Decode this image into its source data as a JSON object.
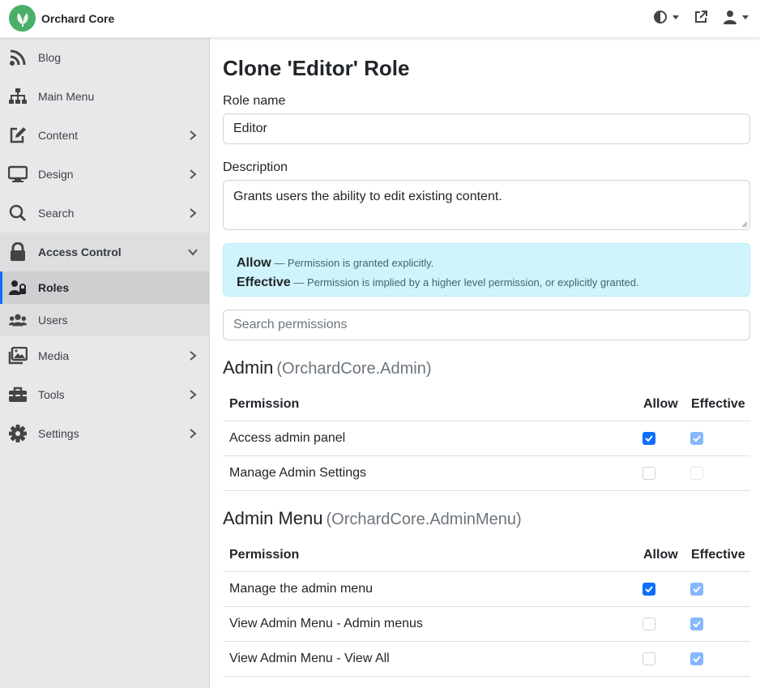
{
  "app": {
    "brand": "Orchard Core"
  },
  "sidebar": {
    "items": [
      {
        "label": "Blog",
        "icon": "rss-icon"
      },
      {
        "label": "Main Menu",
        "icon": "sitemap-icon"
      },
      {
        "label": "Content",
        "icon": "edit-icon"
      },
      {
        "label": "Design",
        "icon": "desktop-icon"
      },
      {
        "label": "Search",
        "icon": "search-icon"
      },
      {
        "label": "Access Control",
        "icon": "lock-icon"
      },
      {
        "label": "Media",
        "icon": "images-icon"
      },
      {
        "label": "Tools",
        "icon": "toolbox-icon"
      },
      {
        "label": "Settings",
        "icon": "gear-icon"
      }
    ],
    "access_children": [
      {
        "label": "Roles",
        "icon": "user-lock-icon",
        "selected": true
      },
      {
        "label": "Users",
        "icon": "users-icon",
        "selected": false
      }
    ]
  },
  "page": {
    "title": "Clone 'Editor' Role",
    "role_name_label": "Role name",
    "role_name_value": "Editor",
    "description_label": "Description",
    "description_value": "Grants users the ability to edit existing content.",
    "legend": {
      "allow_term": "Allow",
      "allow_desc": "— Permission is granted explicitly.",
      "effective_term": "Effective",
      "effective_desc": "— Permission is implied by a higher level permission, or explicitly granted."
    },
    "search_placeholder": "Search permissions"
  },
  "sections": [
    {
      "title": "Admin",
      "namespace": "(OrchardCore.Admin)",
      "headers": {
        "permission": "Permission",
        "allow": "Allow",
        "effective": "Effective"
      },
      "rows": [
        {
          "name": "Access admin panel",
          "allow": true,
          "effective": true
        },
        {
          "name": "Manage Admin Settings",
          "allow": false,
          "effective": false
        }
      ]
    },
    {
      "title": "Admin Menu",
      "namespace": "(OrchardCore.AdminMenu)",
      "headers": {
        "permission": "Permission",
        "allow": "Allow",
        "effective": "Effective"
      },
      "rows": [
        {
          "name": "Manage the admin menu",
          "allow": true,
          "effective": true
        },
        {
          "name": "View Admin Menu - Admin menus",
          "allow": false,
          "effective": true
        },
        {
          "name": "View Admin Menu - View All",
          "allow": false,
          "effective": true
        }
      ]
    }
  ],
  "colors": {
    "accent": "#0d6efd",
    "accent_disabled": "#86b7fe",
    "alert_bg": "#cff4fc",
    "sidebar_bg": "#e8e8ea",
    "brand_green": "#4caf68"
  }
}
